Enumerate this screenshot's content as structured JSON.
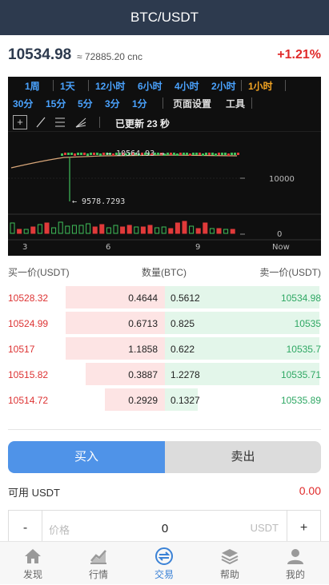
{
  "header": {
    "title": "BTC/USDT"
  },
  "ticker": {
    "last_price": "10534.98",
    "approx": "≈ 72885.20 cnc",
    "change": "+1.21%"
  },
  "chart": {
    "timeframes_row1": [
      {
        "label": "1周",
        "active": false
      },
      {
        "label": "1天",
        "active": false
      },
      {
        "label": "12小时",
        "active": false
      },
      {
        "label": "6小时",
        "active": false
      },
      {
        "label": "4小时",
        "active": false
      },
      {
        "label": "2小时",
        "active": false
      },
      {
        "label": "1小时",
        "active": true
      }
    ],
    "timeframes_row2": [
      {
        "label": "30分",
        "active": false
      },
      {
        "label": "15分",
        "active": false
      },
      {
        "label": "5分",
        "active": false
      },
      {
        "label": "3分",
        "active": false
      },
      {
        "label": "1分",
        "active": false
      }
    ],
    "page_settings_label": "页面设置",
    "tools_label": "工具",
    "updated_label": "已更新 23 秒",
    "high_label": "10564.93",
    "low_label": "9578.7293",
    "y_tick_main": "10000",
    "y_tick_volume": "0",
    "x_ticks": [
      "3",
      "6",
      "9",
      "Now"
    ],
    "colors": {
      "up": "#3fbf5a",
      "down": "#e03a3a",
      "line": "#d9a77a",
      "bg": "#0f0f0f"
    }
  },
  "chart_data": {
    "type": "line",
    "ylim_hint": "10000",
    "high": 10564.93,
    "low": 9578.7293,
    "volume": [
      {
        "v": 0.7,
        "up": true
      },
      {
        "v": 0.25,
        "up": false
      },
      {
        "v": 0.3,
        "up": true
      },
      {
        "v": 0.45,
        "up": false
      },
      {
        "v": 0.6,
        "up": true
      },
      {
        "v": 0.7,
        "up": false
      },
      {
        "v": 0.4,
        "up": true
      },
      {
        "v": 0.75,
        "up": true
      },
      {
        "v": 0.5,
        "up": true
      },
      {
        "v": 0.55,
        "up": true
      },
      {
        "v": 0.55,
        "up": true
      },
      {
        "v": 0.65,
        "up": true
      },
      {
        "v": 0.45,
        "up": false
      },
      {
        "v": 0.6,
        "up": false
      },
      {
        "v": 0.4,
        "up": true
      },
      {
        "v": 0.55,
        "up": true
      },
      {
        "v": 0.45,
        "up": false
      },
      {
        "v": 0.55,
        "up": false
      },
      {
        "v": 0.45,
        "up": true
      },
      {
        "v": 0.45,
        "up": false
      },
      {
        "v": 0.55,
        "up": false
      },
      {
        "v": 0.4,
        "up": true
      },
      {
        "v": 0.45,
        "up": true
      },
      {
        "v": 0.35,
        "up": false
      },
      {
        "v": 0.7,
        "up": false
      },
      {
        "v": 0.85,
        "up": false
      },
      {
        "v": 0.5,
        "up": true
      },
      {
        "v": 0.35,
        "up": false
      },
      {
        "v": 0.7,
        "up": false
      },
      {
        "v": 0.35,
        "up": true
      },
      {
        "v": 0.35,
        "up": false
      },
      {
        "v": 0.3,
        "up": true
      },
      {
        "v": 0.25,
        "up": false
      }
    ]
  },
  "orderbook": {
    "headers": {
      "bid": "买一价(USDT)",
      "qty": "数量(BTC)",
      "ask": "卖一价(USDT)"
    },
    "rows": [
      {
        "bid_price": "10528.32",
        "bid_qty": "0.4644",
        "ask_qty": "0.5612",
        "ask_price": "10534.98",
        "bid_depth": 0.81,
        "ask_depth": 0.99
      },
      {
        "bid_price": "10524.99",
        "bid_qty": "0.6713",
        "ask_qty": "0.825",
        "ask_price": "10535",
        "bid_depth": 0.81,
        "ask_depth": 0.99
      },
      {
        "bid_price": "10517",
        "bid_qty": "1.1858",
        "ask_qty": "0.622",
        "ask_price": "10535.7",
        "bid_depth": 0.81,
        "ask_depth": 0.99
      },
      {
        "bid_price": "10515.82",
        "bid_qty": "0.3887",
        "ask_qty": "1.2278",
        "ask_price": "10535.71",
        "bid_depth": 0.65,
        "ask_depth": 0.99
      },
      {
        "bid_price": "10514.72",
        "bid_qty": "0.2929",
        "ask_qty": "0.1327",
        "ask_price": "10535.89",
        "bid_depth": 0.49,
        "ask_depth": 0.21
      }
    ]
  },
  "trade": {
    "buy_label": "买入",
    "sell_label": "卖出",
    "available_label": "可用 USDT",
    "available_value": "0.00",
    "minus": "-",
    "plus": "+",
    "price_label": "价格",
    "price_value": "0",
    "price_unit": "USDT"
  },
  "nav": {
    "items": [
      {
        "label": "发现",
        "icon": "home-icon",
        "active": false
      },
      {
        "label": "行情",
        "icon": "market-chart-icon",
        "active": false
      },
      {
        "label": "交易",
        "icon": "exchange-icon",
        "active": true
      },
      {
        "label": "帮助",
        "icon": "layers-icon",
        "active": false
      },
      {
        "label": "我的",
        "icon": "user-icon",
        "active": false
      }
    ]
  }
}
